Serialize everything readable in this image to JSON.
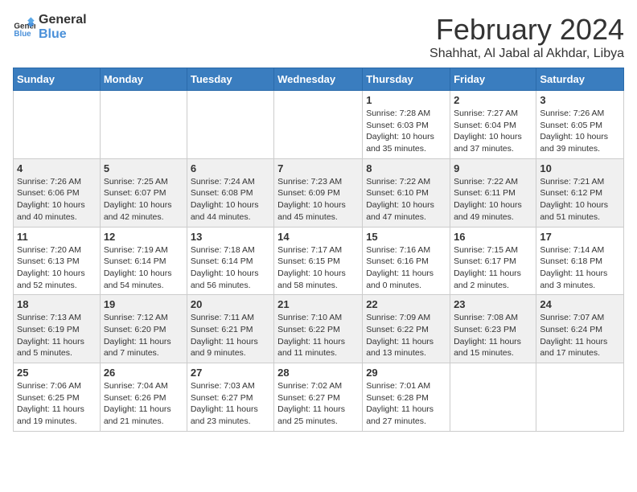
{
  "logo": {
    "line1": "General",
    "line2": "Blue"
  },
  "title": {
    "month_year": "February 2024",
    "location": "Shahhat, Al Jabal al Akhdar, Libya"
  },
  "days_header": [
    "Sunday",
    "Monday",
    "Tuesday",
    "Wednesday",
    "Thursday",
    "Friday",
    "Saturday"
  ],
  "weeks": [
    [
      {
        "day": "",
        "info": ""
      },
      {
        "day": "",
        "info": ""
      },
      {
        "day": "",
        "info": ""
      },
      {
        "day": "",
        "info": ""
      },
      {
        "day": "1",
        "info": "Sunrise: 7:28 AM\nSunset: 6:03 PM\nDaylight: 10 hours and 35 minutes."
      },
      {
        "day": "2",
        "info": "Sunrise: 7:27 AM\nSunset: 6:04 PM\nDaylight: 10 hours and 37 minutes."
      },
      {
        "day": "3",
        "info": "Sunrise: 7:26 AM\nSunset: 6:05 PM\nDaylight: 10 hours and 39 minutes."
      }
    ],
    [
      {
        "day": "4",
        "info": "Sunrise: 7:26 AM\nSunset: 6:06 PM\nDaylight: 10 hours and 40 minutes."
      },
      {
        "day": "5",
        "info": "Sunrise: 7:25 AM\nSunset: 6:07 PM\nDaylight: 10 hours and 42 minutes."
      },
      {
        "day": "6",
        "info": "Sunrise: 7:24 AM\nSunset: 6:08 PM\nDaylight: 10 hours and 44 minutes."
      },
      {
        "day": "7",
        "info": "Sunrise: 7:23 AM\nSunset: 6:09 PM\nDaylight: 10 hours and 45 minutes."
      },
      {
        "day": "8",
        "info": "Sunrise: 7:22 AM\nSunset: 6:10 PM\nDaylight: 10 hours and 47 minutes."
      },
      {
        "day": "9",
        "info": "Sunrise: 7:22 AM\nSunset: 6:11 PM\nDaylight: 10 hours and 49 minutes."
      },
      {
        "day": "10",
        "info": "Sunrise: 7:21 AM\nSunset: 6:12 PM\nDaylight: 10 hours and 51 minutes."
      }
    ],
    [
      {
        "day": "11",
        "info": "Sunrise: 7:20 AM\nSunset: 6:13 PM\nDaylight: 10 hours and 52 minutes."
      },
      {
        "day": "12",
        "info": "Sunrise: 7:19 AM\nSunset: 6:14 PM\nDaylight: 10 hours and 54 minutes."
      },
      {
        "day": "13",
        "info": "Sunrise: 7:18 AM\nSunset: 6:14 PM\nDaylight: 10 hours and 56 minutes."
      },
      {
        "day": "14",
        "info": "Sunrise: 7:17 AM\nSunset: 6:15 PM\nDaylight: 10 hours and 58 minutes."
      },
      {
        "day": "15",
        "info": "Sunrise: 7:16 AM\nSunset: 6:16 PM\nDaylight: 11 hours and 0 minutes."
      },
      {
        "day": "16",
        "info": "Sunrise: 7:15 AM\nSunset: 6:17 PM\nDaylight: 11 hours and 2 minutes."
      },
      {
        "day": "17",
        "info": "Sunrise: 7:14 AM\nSunset: 6:18 PM\nDaylight: 11 hours and 3 minutes."
      }
    ],
    [
      {
        "day": "18",
        "info": "Sunrise: 7:13 AM\nSunset: 6:19 PM\nDaylight: 11 hours and 5 minutes."
      },
      {
        "day": "19",
        "info": "Sunrise: 7:12 AM\nSunset: 6:20 PM\nDaylight: 11 hours and 7 minutes."
      },
      {
        "day": "20",
        "info": "Sunrise: 7:11 AM\nSunset: 6:21 PM\nDaylight: 11 hours and 9 minutes."
      },
      {
        "day": "21",
        "info": "Sunrise: 7:10 AM\nSunset: 6:22 PM\nDaylight: 11 hours and 11 minutes."
      },
      {
        "day": "22",
        "info": "Sunrise: 7:09 AM\nSunset: 6:22 PM\nDaylight: 11 hours and 13 minutes."
      },
      {
        "day": "23",
        "info": "Sunrise: 7:08 AM\nSunset: 6:23 PM\nDaylight: 11 hours and 15 minutes."
      },
      {
        "day": "24",
        "info": "Sunrise: 7:07 AM\nSunset: 6:24 PM\nDaylight: 11 hours and 17 minutes."
      }
    ],
    [
      {
        "day": "25",
        "info": "Sunrise: 7:06 AM\nSunset: 6:25 PM\nDaylight: 11 hours and 19 minutes."
      },
      {
        "day": "26",
        "info": "Sunrise: 7:04 AM\nSunset: 6:26 PM\nDaylight: 11 hours and 21 minutes."
      },
      {
        "day": "27",
        "info": "Sunrise: 7:03 AM\nSunset: 6:27 PM\nDaylight: 11 hours and 23 minutes."
      },
      {
        "day": "28",
        "info": "Sunrise: 7:02 AM\nSunset: 6:27 PM\nDaylight: 11 hours and 25 minutes."
      },
      {
        "day": "29",
        "info": "Sunrise: 7:01 AM\nSunset: 6:28 PM\nDaylight: 11 hours and 27 minutes."
      },
      {
        "day": "",
        "info": ""
      },
      {
        "day": "",
        "info": ""
      }
    ]
  ]
}
